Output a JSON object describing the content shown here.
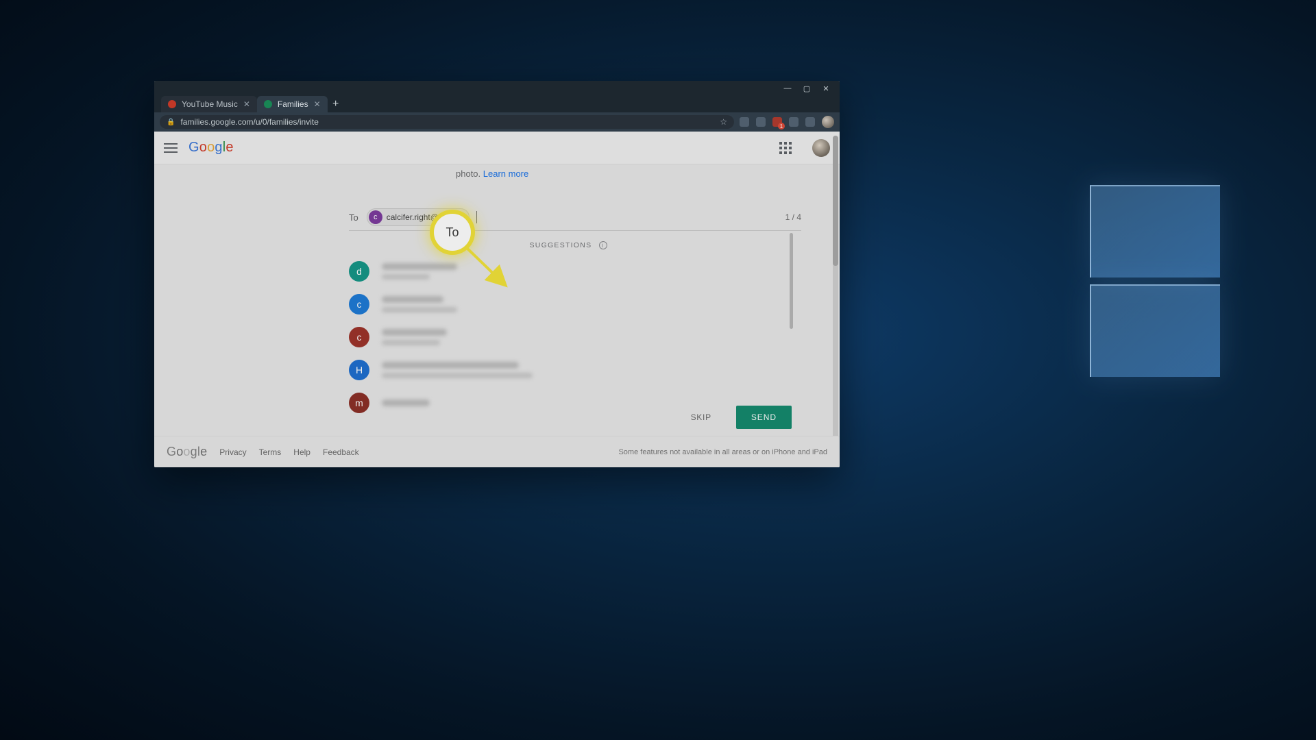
{
  "window": {
    "minimize_glyph": "—",
    "maximize_glyph": "▢",
    "close_glyph": "✕"
  },
  "tabs": [
    {
      "title": "YouTube Music",
      "favicon_color": "#d23c2a",
      "active": false
    },
    {
      "title": "Families",
      "favicon_color": "#1a8f5a",
      "active": true
    }
  ],
  "new_tab_glyph": "+",
  "address_bar": {
    "lock_glyph": "🔒",
    "url": "families.google.com/u/0/families/invite",
    "star_glyph": "☆"
  },
  "appbar": {
    "logo_text": [
      "G",
      "o",
      "o",
      "g",
      "l",
      "e"
    ]
  },
  "body": {
    "prev_text_before": "photo. ",
    "prev_link": "Learn more",
    "to_label": "To",
    "chip_initial": "c",
    "chip_text": "calcifer.right@gma…",
    "count_text": "1 / 4",
    "suggestions_label": "SUGGESTIONS",
    "info_glyph": "i",
    "suggestions": [
      {
        "initial": "d",
        "avatar_class": "teal",
        "line1_w": 110,
        "line2_w": 70
      },
      {
        "initial": "c",
        "avatar_class": "blue",
        "line1_w": 90,
        "line2_w": 110
      },
      {
        "initial": "c",
        "avatar_class": "brick",
        "line1_w": 95,
        "line2_w": 85
      },
      {
        "initial": "H",
        "avatar_class": "blue2",
        "line1_w": 200,
        "line2_w": 220
      },
      {
        "initial": "m",
        "avatar_class": "maroon",
        "line1_w": 70,
        "line2_w": 0
      }
    ],
    "skip_label": "SKIP",
    "send_label": "SEND"
  },
  "footer": {
    "logo_text": [
      "G",
      "o",
      "o",
      "g",
      "l",
      "e"
    ],
    "links": [
      "Privacy",
      "Terms",
      "Help",
      "Feedback"
    ],
    "right_text": "Some features not available in all areas or on iPhone and iPad"
  },
  "annotation": {
    "callout_text": "To"
  }
}
